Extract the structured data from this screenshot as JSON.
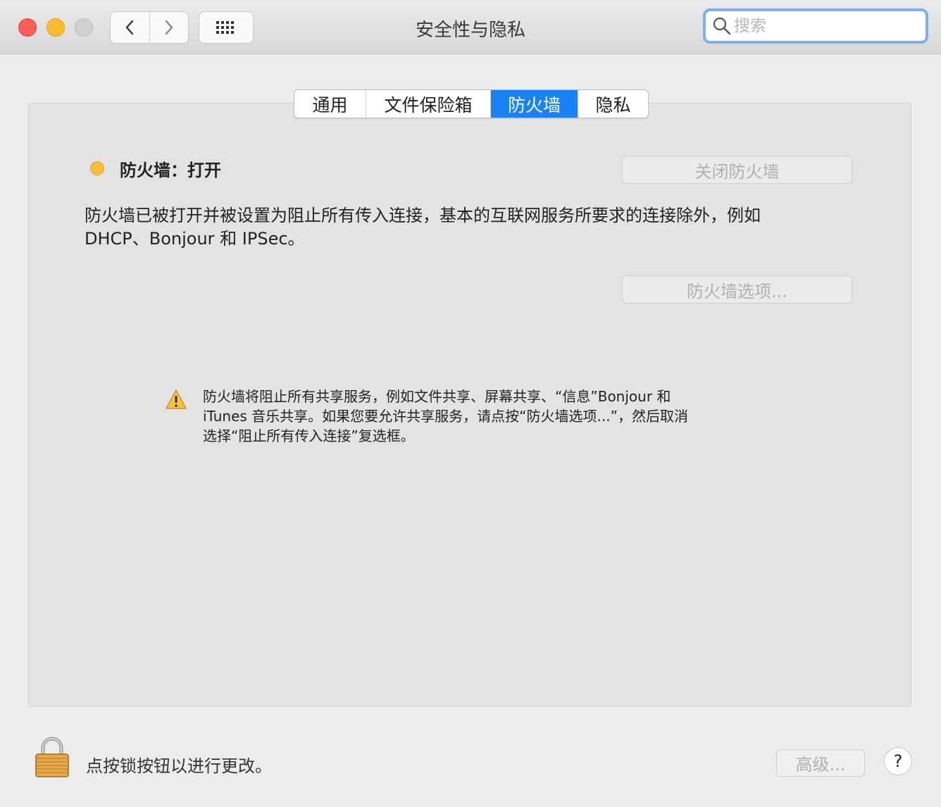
{
  "window": {
    "title": "安全性与隐私",
    "search_placeholder": "搜索"
  },
  "tabs": [
    {
      "label": "通用"
    },
    {
      "label": "文件保险箱"
    },
    {
      "label": "防火墙",
      "active": true
    },
    {
      "label": "隐私"
    }
  ],
  "firewall": {
    "status_label": "防火墙：打开",
    "status_color": "#f8bd3a",
    "turn_off_button": "关闭防火墙",
    "description_line1": "防火墙已被打开并被设置为阻止所有传入连接，基本的互联网服务所要求的连接除外，例如",
    "description_line2": "DHCP、Bonjour 和 IPSec。",
    "options_button": "防火墙选项...",
    "warning_line1": "防火墙将阻止所有共享服务，例如文件共享、屏幕共享、“信息”Bonjour 和",
    "warning_line2": "iTunes 音乐共享。如果您要允许共享服务，请点按“防火墙选项...”，然后取消",
    "warning_line3": "选择“阻止所有传入连接”复选框。"
  },
  "footer": {
    "lock_text": "点按锁按钮以进行更改。",
    "advanced_button": "高级...",
    "help_button": "?"
  }
}
